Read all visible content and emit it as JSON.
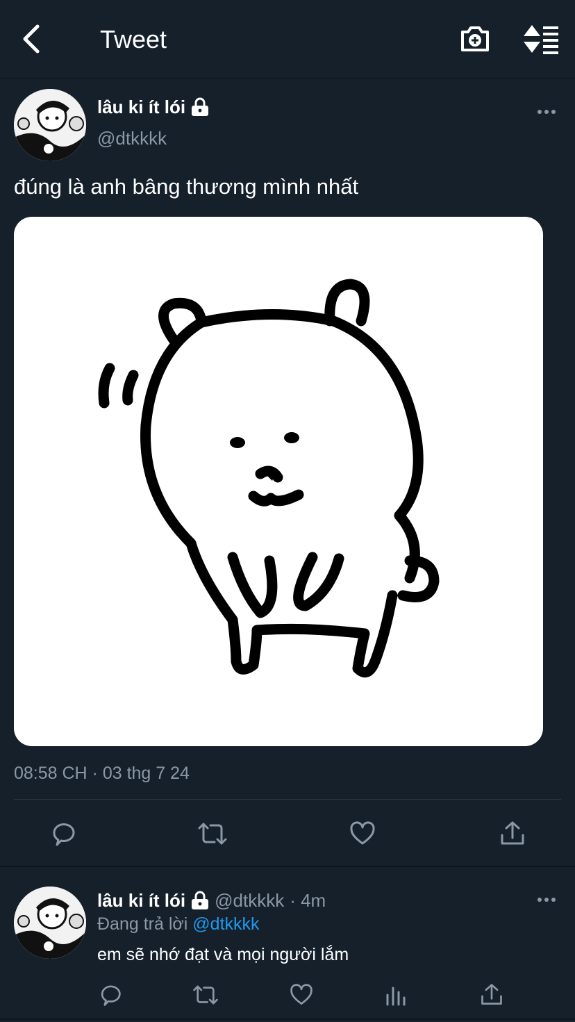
{
  "header": {
    "title": "Tweet"
  },
  "tweet": {
    "author": {
      "display_name": "lâu ki ít lói",
      "handle": "@dtkkkk"
    },
    "text": "đúng là anh bâng thương mình nhất",
    "timestamp": "08:58 CH · 03 thg 7 24"
  },
  "reply": {
    "author": {
      "display_name": "lâu ki ít lói",
      "handle": "@dtkkkk"
    },
    "age": "· 4m",
    "replying_prefix": "Đang trả lời",
    "replying_to": "@dtkkkk",
    "text": "em sẽ nhớ đạt và mọi người lắm"
  },
  "colors": {
    "background": "#15202b",
    "muted": "#8b98a5",
    "link": "#1d9bf0"
  }
}
